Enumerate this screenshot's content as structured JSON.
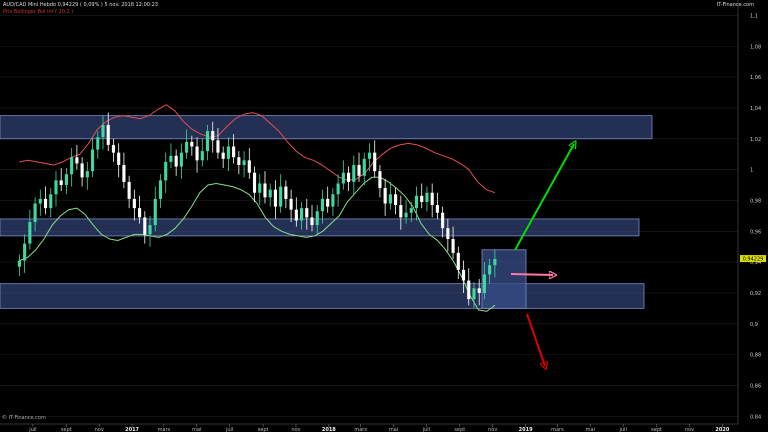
{
  "header": {
    "instrument_line": "AUD/CAD Mini   Hebdo  0,94229 ( 0,09% )   5 nov. 2018 12:00:23",
    "indicator_line": "Prix  Bollinger  Bol inf ( 20,2 )",
    "brand": "IT-Finance.com",
    "copyright": "© IT-Finance.com"
  },
  "colors": {
    "background": "#000000",
    "bull_candle": "#3fd8a0",
    "bear_candle": "#ffffff",
    "upper_band": "#e05050",
    "lower_band": "#88dd88",
    "zone_fill": "#3a4f8a",
    "arrow_up": "#00dd00",
    "arrow_down": "#dd0000",
    "arrow_flat": "#ff77aa",
    "last_price_bg": "#dddd00"
  },
  "chart_data": {
    "type": "candlestick",
    "title": "",
    "ylim": [
      0.835,
      1.11
    ],
    "y_ticks": [
      {
        "value": 1.1,
        "label": "1,1"
      },
      {
        "value": 1.08,
        "label": "1,08"
      },
      {
        "value": 1.06,
        "label": "1,06"
      },
      {
        "value": 1.04,
        "label": "1,04"
      },
      {
        "value": 1.02,
        "label": "1,02"
      },
      {
        "value": 1.0,
        "label": "1"
      },
      {
        "value": 0.98,
        "label": "0,98"
      },
      {
        "value": 0.96,
        "label": "0,96"
      },
      {
        "value": 0.94,
        "label": "0,94"
      },
      {
        "value": 0.92,
        "label": "0,92"
      },
      {
        "value": 0.9,
        "label": "0,9"
      },
      {
        "value": 0.88,
        "label": "0,88"
      },
      {
        "value": 0.86,
        "label": "0,86"
      },
      {
        "value": 0.84,
        "label": "0,84"
      }
    ],
    "x_ticks": [
      {
        "date": "2016-07",
        "label": "juil",
        "year": false
      },
      {
        "date": "2016-09",
        "label": "sept",
        "year": false
      },
      {
        "date": "2016-11",
        "label": "nov",
        "year": false
      },
      {
        "date": "2017-01",
        "label": "2017",
        "year": true
      },
      {
        "date": "2017-03",
        "label": "mars",
        "year": false
      },
      {
        "date": "2017-05",
        "label": "mai",
        "year": false
      },
      {
        "date": "2017-07",
        "label": "juil",
        "year": false
      },
      {
        "date": "2017-09",
        "label": "sept",
        "year": false
      },
      {
        "date": "2017-11",
        "label": "nov",
        "year": false
      },
      {
        "date": "2018-01",
        "label": "2018",
        "year": true
      },
      {
        "date": "2018-03",
        "label": "mars",
        "year": false
      },
      {
        "date": "2018-05",
        "label": "mai",
        "year": false
      },
      {
        "date": "2018-07",
        "label": "juil",
        "year": false
      },
      {
        "date": "2018-09",
        "label": "sept",
        "year": false
      },
      {
        "date": "2018-11",
        "label": "nov",
        "year": false
      },
      {
        "date": "2019-01",
        "label": "2019",
        "year": true
      },
      {
        "date": "2019-03",
        "label": "mars",
        "year": false
      },
      {
        "date": "2019-05",
        "label": "mai",
        "year": false
      },
      {
        "date": "2019-07",
        "label": "juil",
        "year": false
      },
      {
        "date": "2019-09",
        "label": "sept",
        "year": false
      },
      {
        "date": "2019-11",
        "label": "nov",
        "year": false
      },
      {
        "date": "2020-01",
        "label": "2020",
        "year": true
      }
    ],
    "last_price": {
      "value": 0.94229,
      "label": "0,94229"
    },
    "close_series": [
      0.941,
      0.952,
      0.966,
      0.978,
      0.981,
      0.975,
      0.984,
      0.993,
      0.99,
      0.997,
      1.008,
      1.004,
      0.995,
      0.999,
      1.013,
      1.021,
      1.029,
      1.016,
      1.011,
      1.003,
      0.992,
      0.981,
      0.975,
      0.969,
      0.958,
      0.964,
      0.981,
      0.993,
      1.005,
      1.009,
      1.002,
      1.011,
      1.018,
      1.015,
      1.006,
      1.012,
      1.025,
      1.019,
      1.011,
      1.007,
      1.015,
      1.008,
      1.003,
      1.006,
      0.998,
      0.985,
      0.991,
      0.982,
      0.987,
      0.976,
      0.989,
      0.981,
      0.974,
      0.967,
      0.975,
      0.969,
      0.964,
      0.973,
      0.981,
      0.976,
      0.984,
      0.991,
      0.998,
      0.992,
      1.003,
      0.996,
      1.007,
      1.011,
      0.999,
      0.988,
      0.978,
      0.984,
      0.977,
      0.969,
      0.972,
      0.975,
      0.983,
      0.979,
      0.985,
      0.977,
      0.972,
      0.962,
      0.955,
      0.946,
      0.935,
      0.928,
      0.916,
      0.923,
      0.92,
      0.932,
      0.938,
      0.942
    ],
    "upper_band": [
      1.005,
      1.006,
      1.005,
      1.004,
      1.003,
      1.005,
      1.008,
      1.01,
      1.017,
      1.026,
      1.031,
      1.034,
      1.035,
      1.034,
      1.033,
      1.035,
      1.039,
      1.042,
      1.038,
      1.031,
      1.026,
      1.023,
      1.021,
      1.022,
      1.028,
      1.033,
      1.036,
      1.037,
      1.035,
      1.03,
      1.025,
      1.018,
      1.012,
      1.008,
      1.006,
      1.003,
      0.999,
      0.995,
      0.993,
      0.994,
      0.998,
      1.005,
      1.01,
      1.014,
      1.016,
      1.017,
      1.016,
      1.014,
      1.011,
      1.009,
      1.007,
      1.004,
      1.0,
      0.992,
      0.987,
      0.985
    ],
    "lower_band": [
      0.941,
      0.943,
      0.948,
      0.955,
      0.964,
      0.97,
      0.974,
      0.975,
      0.971,
      0.964,
      0.958,
      0.955,
      0.954,
      0.956,
      0.958,
      0.958,
      0.957,
      0.956,
      0.958,
      0.962,
      0.968,
      0.976,
      0.985,
      0.99,
      0.991,
      0.99,
      0.989,
      0.987,
      0.984,
      0.978,
      0.969,
      0.963,
      0.96,
      0.958,
      0.957,
      0.956,
      0.957,
      0.96,
      0.965,
      0.97,
      0.979,
      0.985,
      0.991,
      0.995,
      0.995,
      0.992,
      0.988,
      0.983,
      0.976,
      0.965,
      0.958,
      0.954,
      0.948,
      0.94,
      0.93,
      0.918,
      0.909,
      0.908,
      0.912
    ],
    "zones": [
      {
        "name": "resistance-zone",
        "top": 1.035,
        "bottom": 1.02
      },
      {
        "name": "pivot-zone",
        "top": 0.968,
        "bottom": 0.957
      },
      {
        "name": "support-zone",
        "top": 0.926,
        "bottom": 0.91
      },
      {
        "name": "consolidation-box",
        "top": 0.948,
        "bottom": 0.91
      }
    ]
  }
}
